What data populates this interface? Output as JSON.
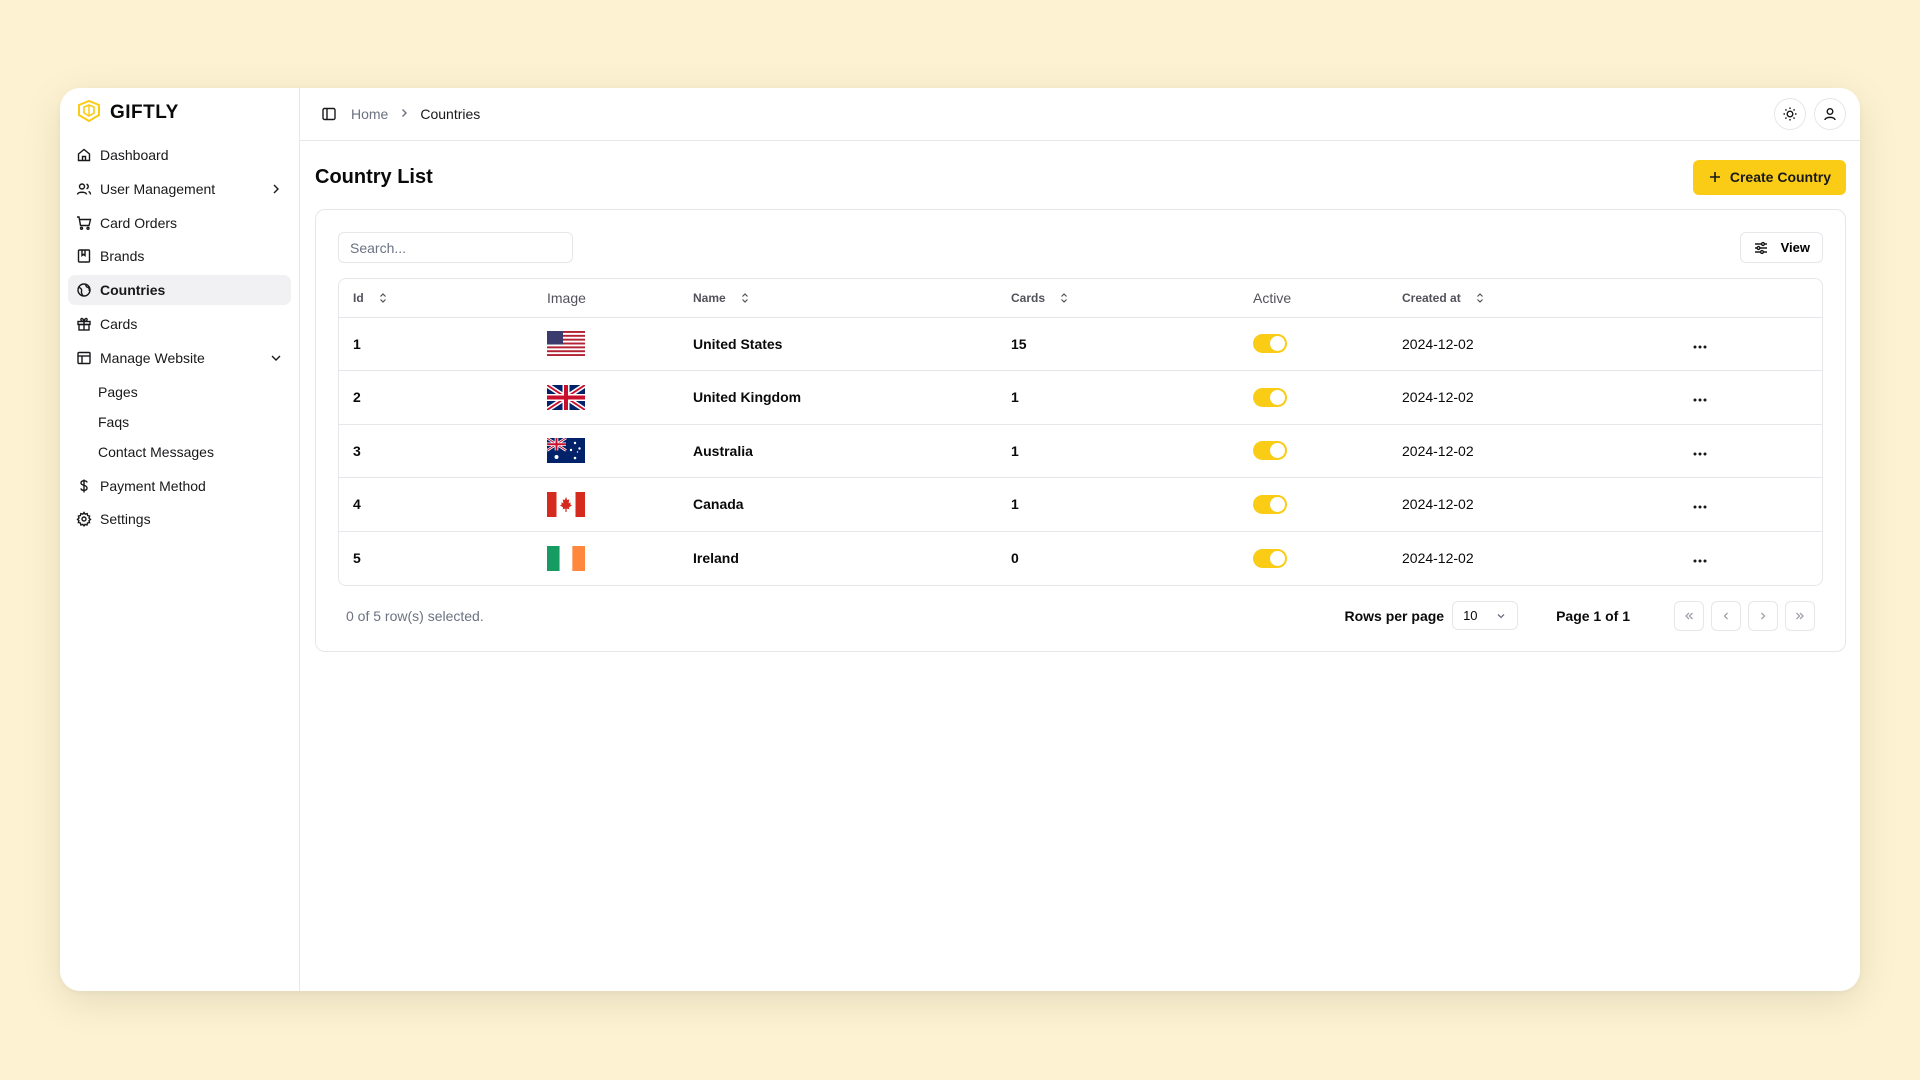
{
  "brand": {
    "name": "GIFTLY"
  },
  "sidebar": {
    "items": [
      {
        "label": "Dashboard",
        "icon": "home-icon"
      },
      {
        "label": "User Management",
        "icon": "users-icon",
        "caret": "chevron-right-icon"
      },
      {
        "label": "Card Orders",
        "icon": "cart-icon"
      },
      {
        "label": "Brands",
        "icon": "bookmark-book-icon"
      },
      {
        "label": "Countries",
        "icon": "globe-icon",
        "active": true
      },
      {
        "label": "Cards",
        "icon": "gift-icon"
      },
      {
        "label": "Manage Website",
        "icon": "layout-icon",
        "caret": "chevron-down-icon"
      }
    ],
    "sub_items": [
      {
        "label": "Pages"
      },
      {
        "label": "Faqs"
      },
      {
        "label": "Contact Messages"
      }
    ],
    "bottom_items": [
      {
        "label": "Payment Method",
        "icon": "dollar-icon"
      },
      {
        "label": "Settings",
        "icon": "gear-icon"
      }
    ]
  },
  "breadcrumb": {
    "home": "Home",
    "current": "Countries"
  },
  "page": {
    "title": "Country List",
    "create_label": "Create Country"
  },
  "toolbar": {
    "search_placeholder": "Search...",
    "view_label": "View"
  },
  "table": {
    "headers": {
      "id": "Id",
      "image": "Image",
      "name": "Name",
      "cards": "Cards",
      "active": "Active",
      "created_at": "Created at"
    },
    "rows": [
      {
        "id": "1",
        "flag": "us-flag-icon",
        "name": "United States",
        "cards": "15",
        "active": true,
        "created_at": "2024-12-02"
      },
      {
        "id": "2",
        "flag": "uk-flag-icon",
        "name": "United Kingdom",
        "cards": "1",
        "active": true,
        "created_at": "2024-12-02"
      },
      {
        "id": "3",
        "flag": "australia-flag-icon",
        "name": "Australia",
        "cards": "1",
        "active": true,
        "created_at": "2024-12-02"
      },
      {
        "id": "4",
        "flag": "canada-flag-icon",
        "name": "Canada",
        "cards": "1",
        "active": true,
        "created_at": "2024-12-02"
      },
      {
        "id": "5",
        "flag": "ireland-flag-icon",
        "name": "Ireland",
        "cards": "0",
        "active": true,
        "created_at": "2024-12-02"
      }
    ]
  },
  "footer": {
    "selected_text": "0 of 5 row(s) selected.",
    "rows_per_page_label": "Rows per page",
    "rows_per_page_value": "10",
    "page_indicator": "Page 1 of 1"
  },
  "colors": {
    "accent": "#facc15",
    "background": "#fdf3d2"
  }
}
